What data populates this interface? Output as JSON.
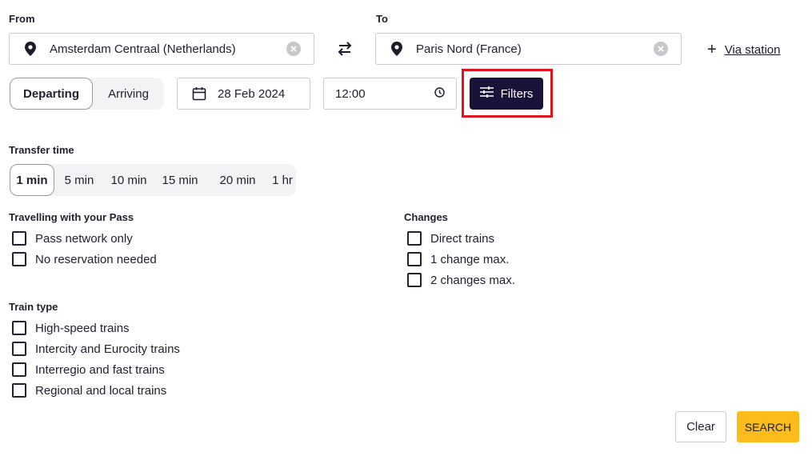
{
  "from": {
    "label": "From",
    "value": "Amsterdam Centraal (Netherlands)"
  },
  "to": {
    "label": "To",
    "value": "Paris Nord (France)"
  },
  "via_label": "Via station",
  "direction": {
    "options": [
      "Departing",
      "Arriving"
    ],
    "selected": "Departing"
  },
  "date": "28 Feb 2024",
  "time": "12:00",
  "filters_label": "Filters",
  "transfer_time": {
    "label": "Transfer time",
    "options": [
      "1 min",
      "5 min",
      "10 min",
      "15 min",
      "20 min",
      "1 hr"
    ],
    "selected": "1 min"
  },
  "pass": {
    "label": "Travelling with your Pass",
    "options": [
      "Pass network only",
      "No reservation needed"
    ]
  },
  "changes": {
    "label": "Changes",
    "options": [
      "Direct trains",
      "1 change max.",
      "2 changes max."
    ]
  },
  "train_type": {
    "label": "Train type",
    "options": [
      "High-speed trains",
      "Intercity and Eurocity trains",
      "Interregio and fast trains",
      "Regional and local trains"
    ]
  },
  "buttons": {
    "clear": "Clear",
    "search": "SEARCH"
  },
  "colors": {
    "filters_bg": "#1a1238",
    "highlight": "#e0141e",
    "search_bg": "#fbbc1c"
  }
}
